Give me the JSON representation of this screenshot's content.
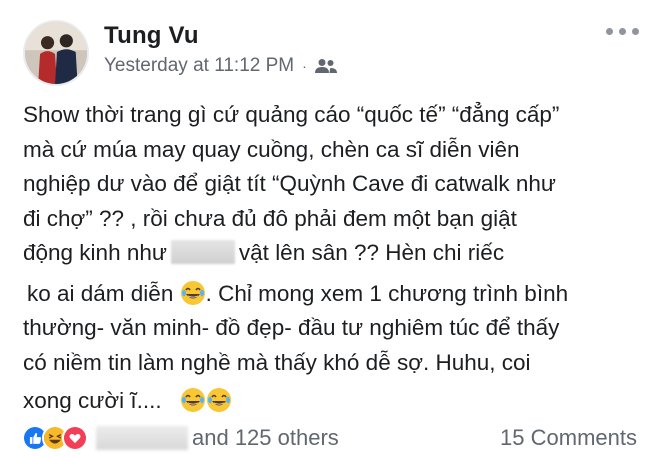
{
  "post": {
    "author": "Tung Vu",
    "timestamp": "Yesterday at 11:12 PM",
    "separator": "·",
    "audience_icon": "friends-icon",
    "lines": [
      "Show thời trang gì cứ quảng cáo “quốc tế” “đẳng cấp”",
      "mà cứ múa may quay cuồng, chèn ca sĩ diễn viên",
      "nghiệp dư vào để giật tít “Quỳnh Cave đi catwalk như",
      "đi chợ” ?? , rồi chưa đủ đô phải đem một bạn giật",
      "động kinh như",
      "vật lên sân ?? Hèn chi riếc",
      "ko ai dám diễn",
      ". Chỉ mong xem 1 chương trình bình",
      "thường- văn minh- đồ đẹp- đầu tư nghiêm túc để thấy",
      "có niềm tin làm nghề mà thấy khó dễ sợ. Huhu, coi",
      "xong cười ĩ...."
    ],
    "emoji_name": "laughing-tears-emoji"
  },
  "footer": {
    "reaction_icons": [
      "like-icon",
      "haha-icon",
      "love-icon"
    ],
    "others_text": "and 125 others",
    "comments_text": "15 Comments"
  },
  "colors": {
    "like": "#1877f2",
    "haha": "#f7b928",
    "love": "#f33e58",
    "meta_text": "#616770"
  }
}
